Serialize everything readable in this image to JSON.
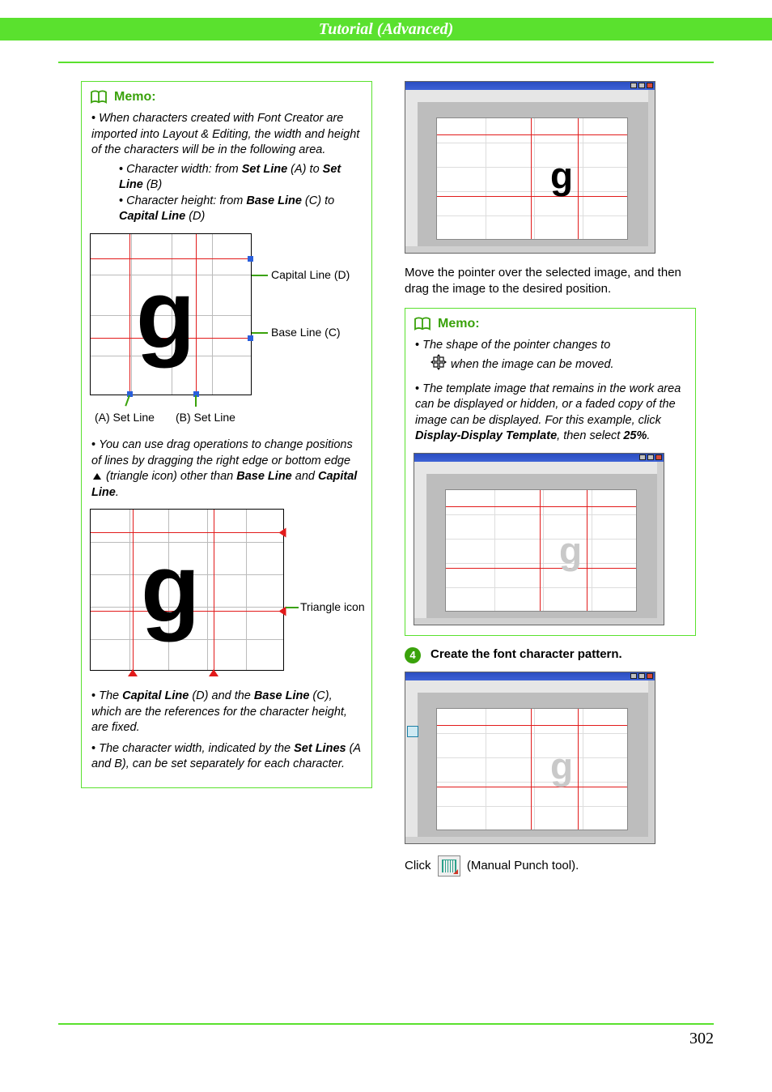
{
  "header": {
    "title": "Tutorial (Advanced)"
  },
  "footer": {
    "page": "302"
  },
  "left": {
    "memo": {
      "title": "Memo:",
      "p1_a": "When characters created with Font Creator are imported into Layout & Editing, the width and height of the characters will be in the following area.",
      "s1_a": "Character width: from ",
      "s1_b": "Set Line",
      "s1_c": " (A) to ",
      "s1_d": "Set Line",
      "s1_e": " (B)",
      "s2_a": "Character height: from ",
      "s2_b": "Base Line",
      "s2_c": " (C) to ",
      "s2_d": "Capital Line",
      "s2_e": " (D)",
      "diag1": {
        "capital": "Capital Line (D)",
        "base": "Base Line (C)",
        "setA": "(A) Set Line",
        "setB": "(B) Set Line"
      },
      "p2_a": "You can use drag operations to change positions of lines by dragging the right edge or bottom edge ",
      "p2_b": " (triangle icon) other than ",
      "p2_c": "Base Line",
      "p2_d": " and ",
      "p2_e": "Capital Line",
      "p2_f": ".",
      "diag2": {
        "tri": "Triangle icon"
      },
      "p3_a": "The ",
      "p3_b": "Capital Line",
      "p3_c": " (D) and the ",
      "p3_d": "Base Line",
      "p3_e": " (C), which are the references for the character height, are fixed.",
      "p4_a": "The character width, indicated by the ",
      "p4_b": "Set Lines",
      "p4_c": " (A and B), can be set separately for each character."
    }
  },
  "right": {
    "moveText": "Move the pointer over the selected image, and then drag the image to the desired position.",
    "memo": {
      "title": "Memo:",
      "p1": "The shape of the pointer changes to",
      "p1b": " when the image can be moved.",
      "p2_a": "The template image that remains in the work area can be displayed or hidden, or a faded copy of the image can be displayed. For this example, click ",
      "p2_b": "Display-Display Template",
      "p2_c": ", then select ",
      "p2_d": "25%",
      "p2_e": "."
    },
    "step4": {
      "num": "4",
      "text": "Create the font character pattern."
    },
    "click_a": "Click ",
    "click_b": " (Manual Punch tool)."
  }
}
